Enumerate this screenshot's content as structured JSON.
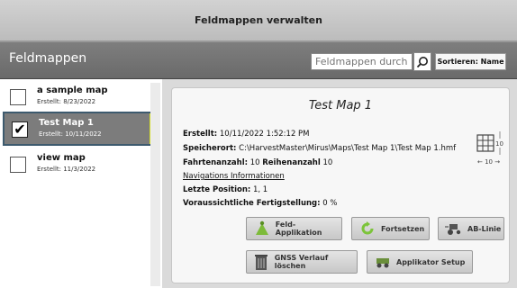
{
  "window": {
    "title": "Feldmappen verwalten"
  },
  "toolbar": {
    "section_title": "Feldmappen",
    "search_placeholder": "Feldmappen durchsuchen",
    "sort_label": "Sortieren: Name"
  },
  "maps": [
    {
      "name": "a sample map",
      "created": "Erstellt: 8/23/2022",
      "checked": false
    },
    {
      "name": "Test Map 1",
      "created": "Erstellt: 10/11/2022",
      "checked": true,
      "check_glyph": "✔"
    },
    {
      "name": "view map",
      "created": "Erstellt: 11/3/2022",
      "checked": false
    }
  ],
  "detail": {
    "title": "Test Map 1",
    "created_label": "Erstellt:",
    "created_value": "10/11/2022 1:52:12 PM",
    "location_label": "Speicherort:",
    "location_value": "C:\\HarvestMaster\\Mirus\\Maps\\Test Map 1\\Test Map 1.hmf",
    "lanes_label": "Fahrtenanzahl:",
    "lanes_value": "10",
    "rows_label": "Reihenanzahl",
    "rows_value": "10",
    "nav_info_link": "Navigations Informationen",
    "last_position_label": "Letzte Position:",
    "last_position_value": "1, 1",
    "completion_label": "Voraussichtliche Fertigstellung:",
    "completion_value": "0 %",
    "grid_rows": "10",
    "grid_cols": "← 10 →"
  },
  "actions": {
    "field_application": "Feld-Applikation",
    "continue": "Fortsetzen",
    "ab_line": "AB-Linie",
    "clear_gnss": "GNSS Verlauf löschen",
    "applicator_setup": "Applikator Setup"
  },
  "colors": {
    "selection_accent": "#d5df2a",
    "selected_row_bg": "#7c7c7c",
    "toolbar_bg": "#727272"
  }
}
